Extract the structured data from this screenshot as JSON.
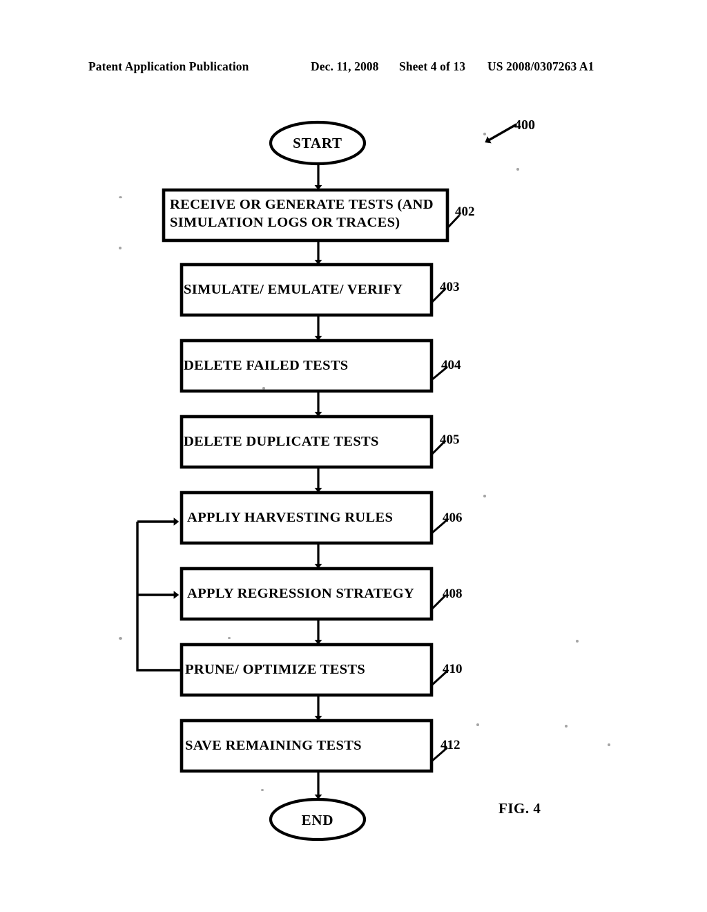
{
  "header": {
    "publication": "Patent Application Publication",
    "date": "Dec. 11, 2008",
    "sheet": "Sheet 4 of 13",
    "patent_number": "US 2008/0307263 A1"
  },
  "figure": {
    "caption": "FIG. 4",
    "diagram_reference": "400",
    "start_label": "START",
    "end_label": "END",
    "steps": [
      {
        "id": "402",
        "label_line1": "RECEIVE OR GENERATE TESTS (AND",
        "label_line2": "SIMULATION LOGS OR TRACES)"
      },
      {
        "id": "403",
        "label_line1": "SIMULATE/ EMULATE/ VERIFY",
        "label_line2": ""
      },
      {
        "id": "404",
        "label_line1": "DELETE FAILED TESTS",
        "label_line2": ""
      },
      {
        "id": "405",
        "label_line1": "DELETE DUPLICATE TESTS",
        "label_line2": ""
      },
      {
        "id": "406",
        "label_line1": "APPLIY HARVESTING RULES",
        "label_line2": ""
      },
      {
        "id": "408",
        "label_line1": "APPLY REGRESSION STRATEGY",
        "label_line2": ""
      },
      {
        "id": "410",
        "label_line1": "PRUNE/ OPTIMIZE TESTS",
        "label_line2": ""
      },
      {
        "id": "412",
        "label_line1": "SAVE REMAINING TESTS",
        "label_line2": ""
      }
    ]
  },
  "colors": {
    "ink": "#000000",
    "paper": "#ffffff"
  }
}
